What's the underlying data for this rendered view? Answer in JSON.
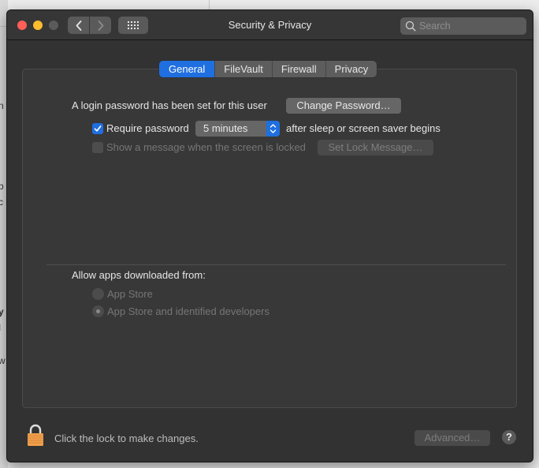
{
  "background": {
    "fragments": [
      "n",
      "b",
      "c",
      "y",
      "I",
      "w"
    ]
  },
  "window": {
    "title": "Security & Privacy",
    "search": {
      "placeholder": "Search",
      "value": ""
    },
    "toolbar": {
      "back_icon": "chevron-left",
      "forward_icon": "chevron-right",
      "grid_icon": "show-all-grid"
    }
  },
  "tabs": [
    {
      "label": "General",
      "active": true
    },
    {
      "label": "FileVault",
      "active": false
    },
    {
      "label": "Firewall",
      "active": false
    },
    {
      "label": "Privacy",
      "active": false
    }
  ],
  "general": {
    "login_password_text": "A login password has been set for this user",
    "change_password_label": "Change Password…",
    "require_password": {
      "label": "Require password",
      "checked": true,
      "selected_option": "5 minutes",
      "suffix": "after sleep or screen saver begins"
    },
    "show_message": {
      "label": "Show a message when the screen is locked",
      "checked": false,
      "enabled": false,
      "button_label": "Set Lock Message…"
    },
    "allow_apps": {
      "heading": "Allow apps downloaded from:",
      "options": [
        {
          "label": "App Store",
          "selected": false,
          "enabled": false
        },
        {
          "label": "App Store and identified developers",
          "selected": true,
          "enabled": false
        }
      ]
    }
  },
  "footer": {
    "lock_text": "Click the lock to make changes.",
    "advanced_label": "Advanced…",
    "help_label": "?",
    "lock_color": "#f0a04a"
  },
  "colors": {
    "accent": "#1f6fe0",
    "window_bg": "#323232",
    "close": "#fe5f57",
    "minimize": "#febc2e"
  }
}
